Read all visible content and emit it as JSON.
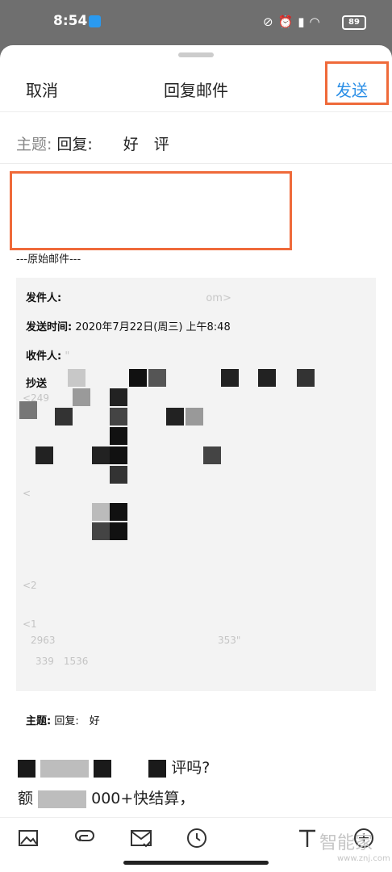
{
  "status": {
    "time": "8:54",
    "battery": "89"
  },
  "nav": {
    "cancel": "取消",
    "title": "回复邮件",
    "send": "发送"
  },
  "subject": {
    "label": "主题:",
    "value": "回复:　　好　评"
  },
  "divider": "---原始邮件---",
  "original": {
    "from_label": "发件人:",
    "from_tail": "om>",
    "time_label": "发送时间:",
    "time_value": "2020年7月22日(周三) 上午8:48",
    "to_label": "收件人:",
    "to_tail": "\"",
    "cc_label": "抄送",
    "subject_label": "主题:",
    "subject_value": "回复:　好"
  },
  "reply": {
    "line1_end": "评吗?",
    "line2_start": "额",
    "line2_end": "000+快结算，"
  },
  "toolbar": {
    "items": [
      {
        "name": "image-icon"
      },
      {
        "name": "attachment-icon"
      },
      {
        "name": "mail-check-icon"
      },
      {
        "name": "clock-icon"
      },
      {
        "name": "text-format-icon"
      },
      {
        "name": "add-icon"
      }
    ]
  },
  "watermark": {
    "main": "智能家",
    "sub": "www.znj.com"
  },
  "colors": {
    "accent": "#2a8ee6",
    "highlight": "#ef6a3a"
  }
}
